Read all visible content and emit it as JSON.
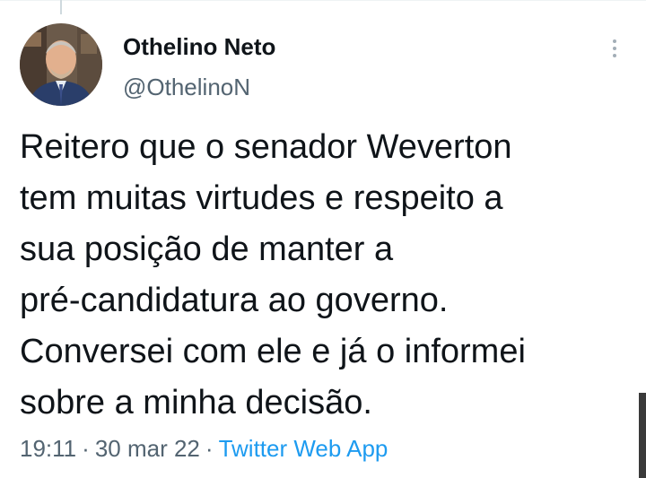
{
  "tweet": {
    "author": {
      "name": "Othelino Neto",
      "handle": "@OthelinoN"
    },
    "text_lines": [
      "Reitero que o senador Weverton",
      "tem muitas virtudes e respeito a",
      "sua posição de manter a",
      "pré-candidatura ao governo.",
      "Conversei com ele e já o informei",
      "sobre a minha decisão."
    ],
    "time": "19:11",
    "date": "30 mar 22",
    "separator": "·",
    "source": "Twitter Web App"
  },
  "icons": {
    "more": "more-vertical-icon"
  },
  "colors": {
    "text": "#0f1419",
    "secondary": "#536471",
    "link": "#1d9bf0"
  }
}
